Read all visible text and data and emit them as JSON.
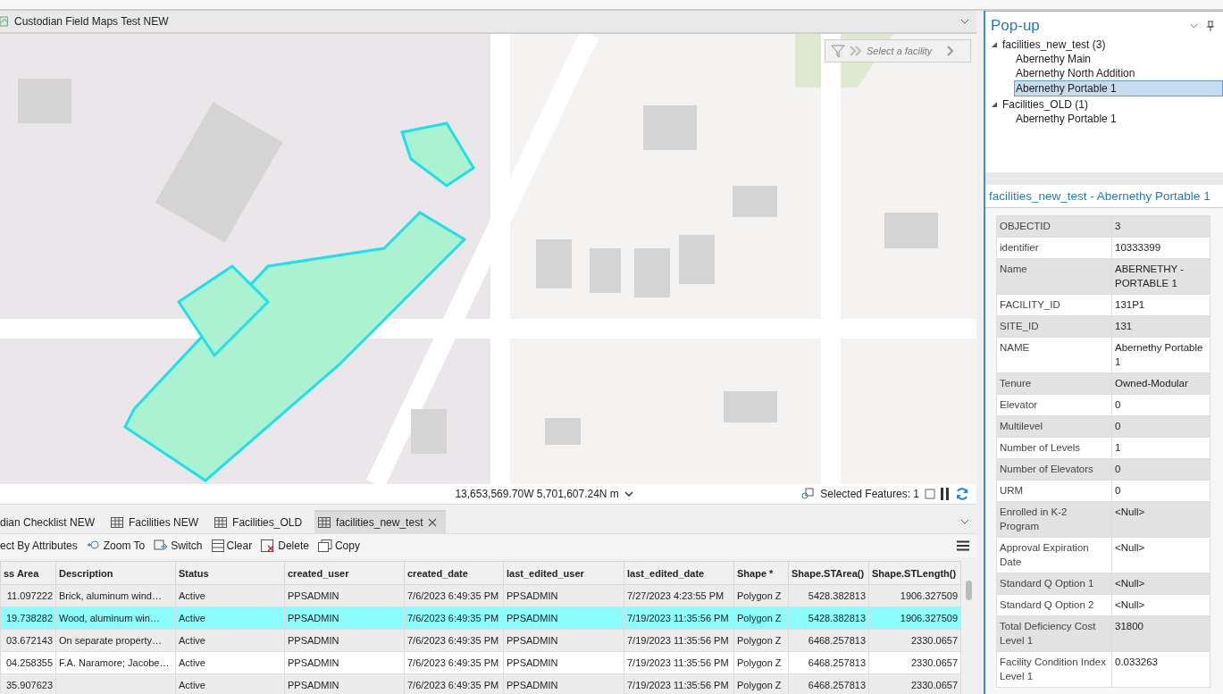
{
  "map_view": {
    "title": "Custodian Field Maps Test NEW",
    "facility_selector": {
      "placeholder": "Select a facility"
    },
    "coordinates": "13,653,569.70W 5,701,607.24N m",
    "selected_features": "Selected Features: 1"
  },
  "table_tabs": [
    {
      "label": "dian Checklist NEW",
      "selected": false
    },
    {
      "label": "Facilities NEW",
      "selected": false
    },
    {
      "label": "Facilities_OLD",
      "selected": false
    },
    {
      "label": "facilities_new_test",
      "selected": true
    }
  ],
  "toolbar": [
    "ect By Attributes",
    "Zoom To",
    "Switch",
    "Clear",
    "Delete",
    "Copy"
  ],
  "table": {
    "columns": [
      "ss Area",
      "Description",
      "Status",
      "created_user",
      "created_date",
      "last_edited_user",
      "last_edited_date",
      "Shape *",
      "Shape.STArea()",
      "Shape.STLength()"
    ],
    "rows": [
      {
        "selected": false,
        "cells": [
          "11.097222",
          "Brick, aluminum wind…",
          "Active",
          "PPSADMIN",
          "7/6/2023 6:49:35 PM",
          "PPSADMIN",
          "7/27/2023 4:23:55 PM",
          "Polygon Z",
          "5428.382813",
          "1906.327509"
        ]
      },
      {
        "selected": true,
        "cells": [
          "19.738282",
          "Wood, aluminum win…",
          "Active",
          "PPSADMIN",
          "7/6/2023 6:49:35 PM",
          "PPSADMIN",
          "7/19/2023 11:35:56 PM",
          "Polygon Z",
          "5428.382813",
          "1906.327509"
        ]
      },
      {
        "selected": false,
        "cells": [
          "03.672143",
          "On separate property…",
          "Active",
          "PPSADMIN",
          "7/6/2023 6:49:35 PM",
          "PPSADMIN",
          "7/19/2023 11:35:56 PM",
          "Polygon Z",
          "6468.257813",
          "2330.0657"
        ]
      },
      {
        "selected": false,
        "cells": [
          "04.258355",
          "F.A. Naramore;  Jacobe…",
          "Active",
          "PPSADMIN",
          "7/6/2023 6:49:35 PM",
          "PPSADMIN",
          "7/19/2023 11:35:56 PM",
          "Polygon Z",
          "6468.257813",
          "2330.0657"
        ]
      },
      {
        "selected": false,
        "cells": [
          "35.907623",
          "",
          "Active",
          "PPSADMIN",
          "7/6/2023 6:49:35 PM",
          "PPSADMIN",
          "7/19/2023 11:35:56 PM",
          "Polygon Z",
          "6468.257813",
          "2330.0657"
        ]
      }
    ]
  },
  "popup": {
    "title": "Pop-up",
    "tree": [
      {
        "label": "facilities_new_test (3)",
        "expanded": true,
        "children": [
          {
            "label": "Abernethy Main",
            "selected": false
          },
          {
            "label": "Abernethy North Addition",
            "selected": false
          },
          {
            "label": "Abernethy Portable 1",
            "selected": true
          }
        ]
      },
      {
        "label": "Facilities_OLD (1)",
        "expanded": true,
        "children": [
          {
            "label": "Abernethy Portable 1",
            "selected": false
          }
        ]
      }
    ],
    "feature_title": "facilities_new_test - Abernethy Portable 1",
    "attributes": [
      {
        "field": "OBJECTID",
        "value": "3"
      },
      {
        "field": "identifier",
        "value": "10333399"
      },
      {
        "field": "Name",
        "value": "ABERNETHY - PORTABLE 1"
      },
      {
        "field": "FACILITY_ID",
        "value": "131P1"
      },
      {
        "field": "SITE_ID",
        "value": "131"
      },
      {
        "field": "NAME",
        "value": "Abernethy Portable 1"
      },
      {
        "field": "Tenure",
        "value": "Owned-Modular"
      },
      {
        "field": "Elevator",
        "value": "0"
      },
      {
        "field": "Multilevel",
        "value": "0"
      },
      {
        "field": "Number of Levels",
        "value": "1"
      },
      {
        "field": "Number of Elevators",
        "value": "0"
      },
      {
        "field": "URM",
        "value": "0"
      },
      {
        "field": "Enrolled in K-2 Program",
        "value": "<Null>"
      },
      {
        "field": "Approval Expiration Date",
        "value": "<Null>"
      },
      {
        "field": "Standard Q Option 1",
        "value": "<Null>"
      },
      {
        "field": "Standard Q Option 2",
        "value": "<Null>"
      },
      {
        "field": "Total Deficiency Cost Level 1",
        "value": "31800"
      },
      {
        "field": "Facility Condition Index Level 1",
        "value": "0.033263"
      }
    ]
  }
}
